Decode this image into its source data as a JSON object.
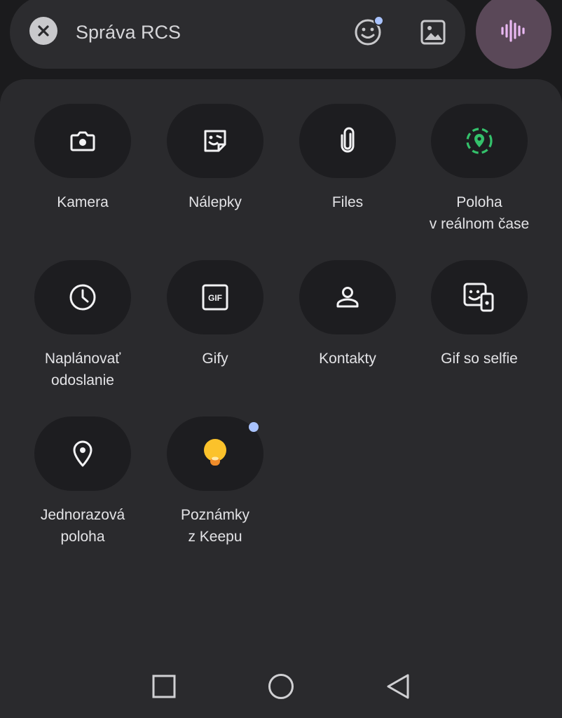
{
  "compose": {
    "placeholder": "Správa RCS",
    "close_icon": "close-icon",
    "emoji_icon": "emoji-icon",
    "gallery_icon": "gallery-icon",
    "voice_icon": "voice-waveform-icon"
  },
  "attachments": [
    {
      "label": "Kamera",
      "icon": "camera-icon"
    },
    {
      "label": "Nálepky",
      "icon": "sticker-icon"
    },
    {
      "label": "Files",
      "icon": "paperclip-icon"
    },
    {
      "label": "Poloha\nv reálnom čase",
      "icon": "live-location-icon"
    },
    {
      "label": "Naplánovať\nodoslanie",
      "icon": "clock-icon"
    },
    {
      "label": "Gify",
      "icon": "gif-icon"
    },
    {
      "label": "Kontakty",
      "icon": "contact-icon"
    },
    {
      "label": "Gif so selfie",
      "icon": "selfie-gif-icon"
    },
    {
      "label": "Jednorazová\npoloha",
      "icon": "location-pin-icon"
    },
    {
      "label": "Poznámky\nz Keepu",
      "icon": "keep-bulb-icon"
    }
  ],
  "navbar": {
    "recents_icon": "recents-square-icon",
    "home_icon": "home-circle-icon",
    "back_icon": "back-triangle-icon"
  },
  "colors": {
    "background": "#1b1b1d",
    "panel": "#2a2a2d",
    "tile": "#1d1d20",
    "compose_bar": "#2c2c2f",
    "voice_button": "#5a4858",
    "voice_icon": "#e9b8f2",
    "live_location_green": "#34c16b",
    "notification_dot": "#a9c3ff",
    "keep_yellow": "#fbc22b",
    "keep_orange": "#f08c2a"
  }
}
